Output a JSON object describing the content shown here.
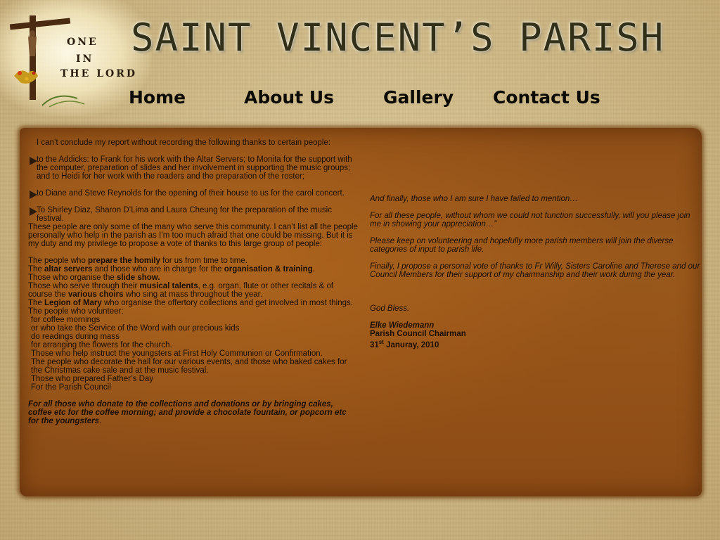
{
  "site": {
    "title": "SAINT VINCENT’S PARISH",
    "logo_lines": [
      "ONE",
      "IN",
      "THE LORD"
    ]
  },
  "nav": {
    "home": "Home",
    "about": "About Us",
    "gallery": "Gallery",
    "contact": "Contact Us"
  },
  "left": {
    "intro": "I can’t conclude my report without recording the following thanks to certain people:",
    "thanks": [
      "to the Addicks: to Frank for his work with the Altar Servers; to Monita for the support with the computer, preparation of slides and her involvement in supporting the music groups; and to Heidi for her work with the readers and the preparation of the roster;",
      "to Diane and Steve Reynolds for the opening of their house to us for the carol concert.",
      "To Shirley Diaz, Sharon D’Lima and Laura Cheung  for the preparation of the music festival."
    ],
    "service_para": "These people are only some of the many who serve this community. I can’t list all the people personally who help in the parish as I’m too much afraid that one could be missing. But it is my duty and my privilege to propose a vote of thanks to this large group of people:",
    "line1_pre": "The people who ",
    "line1_bold": "prepare the homily",
    "line1_post": " for us from time to time.",
    "line2_pre": "The ",
    "line2_bold1": "altar servers",
    "line2_mid": " and those who are in charge for the ",
    "line2_bold2": "organisation & training",
    "line2_post": ".",
    "line3_pre": "Those who organise the ",
    "line3_bold": "slide show.",
    "line4_pre": "Those who serve through their ",
    "line4_bold1": "musical talents",
    "line4_mid": ", e.g. organ, flute or other recitals & of course the ",
    "line4_bold2": "various choirs",
    "line4_post": " who sing at mass throughout the year.",
    "line5_pre": "The ",
    "line5_bold": "Legion of Mary",
    "line5_post": " who organise the offertory collections and get involved in most things.",
    "volunteer_head": "The people who volunteer:",
    "volunteer_items": [
      "for coffee mornings",
      "or who take the Service of the Word with our precious kids",
      "do readings during mass",
      "for arranging the flowers for the church.",
      "Those who help instruct the youngsters at First Holy Communion or Confirmation.",
      "The people who decorate the hall for our various events, and those who baked cakes for the Christmas cake sale and at the music festival.",
      "Those who prepared  Father’s Day",
      "For the Parish Council"
    ],
    "closing_bold_italic": "For all those who donate to the collections and donations or by bringing cakes, coffee etc for the coffee morning; and provide a chocolate fountain, or popcorn etc for the youngsters",
    "closing_end": "."
  },
  "right": {
    "p1": "And finally, those who I am sure I have failed to mention…",
    "p2": "For all these people, without whom we could not function successfully, will you please join me in showing your appreciation…”",
    "p3": "Please keep on volunteering and hopefully more parish members will join the diverse categories of input to parish life.",
    "p4": "Finally, I propose a personal vote of thanks to Fr Willy, Sisters Caroline and Therese and our Council Members for their support of my chairmanship and their work during the year.",
    "blessing": "God Bless.",
    "signer_name": "Elke Wiedemann",
    "signer_role": "Parish Council Chairman",
    "date_day": "31",
    "date_suffix": "st",
    "date_rest": " Januray, 2010"
  }
}
